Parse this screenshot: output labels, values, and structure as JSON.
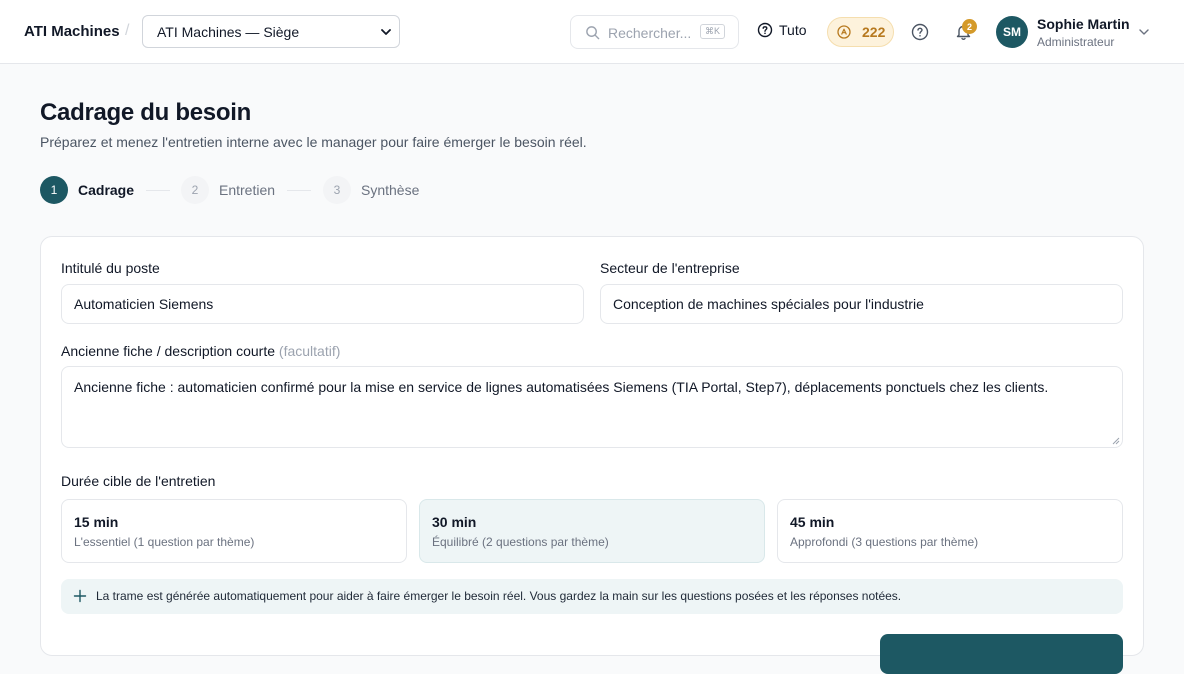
{
  "header": {
    "brand": "ATI Machines",
    "separator": "/",
    "org_select": "ATI Machines — Siège",
    "search_placeholder": "Rechercher...",
    "search_shortcut": "⌘K",
    "tuto_label": "Tuto",
    "credits": "222",
    "notifications_count": "2",
    "user": {
      "initials": "SM",
      "name": "Sophie Martin",
      "role": "Administrateur"
    }
  },
  "page": {
    "title": "Cadrage du besoin",
    "subtitle": "Préparez et menez l'entretien interne avec le manager pour faire émerger le besoin réel."
  },
  "stepper": [
    {
      "num": "1",
      "label": "Cadrage",
      "state": "active"
    },
    {
      "num": "2",
      "label": "Entretien",
      "state": "inactive"
    },
    {
      "num": "3",
      "label": "Synthèse",
      "state": "inactive"
    }
  ],
  "form": {
    "job_title": {
      "label": "Intitulé du poste",
      "value": "Automaticien Siemens"
    },
    "sector": {
      "label": "Secteur de l'entreprise",
      "value": "Conception de machines spéciales pour l'industrie"
    },
    "old_sheet": {
      "label": "Ancienne fiche / description courte",
      "optional": "(facultatif)",
      "value": "Ancienne fiche : automaticien confirmé pour la mise en service de lignes automatisées Siemens (TIA Portal, Step7), déplacements ponctuels chez les clients."
    },
    "duration": {
      "label": "Durée cible de l'entretien",
      "selected": "30 min",
      "options": [
        {
          "title": "15 min",
          "desc": "L'essentiel (1 question par thème)"
        },
        {
          "title": "30 min",
          "desc": "Équilibré (2 questions par thème)"
        },
        {
          "title": "45 min",
          "desc": "Approfondi (3 questions par thème)"
        }
      ]
    },
    "info": "La trame est générée automatiquement pour aider à faire émerger le besoin réel. Vous gardez la main sur les questions posées et les réponses notées."
  },
  "colors": {
    "accent": "#1d5863",
    "credit_bg": "#fdf2dc",
    "credit_text": "#b7791f",
    "badge": "#d49a2a",
    "selected_bg": "#eef5f6"
  }
}
